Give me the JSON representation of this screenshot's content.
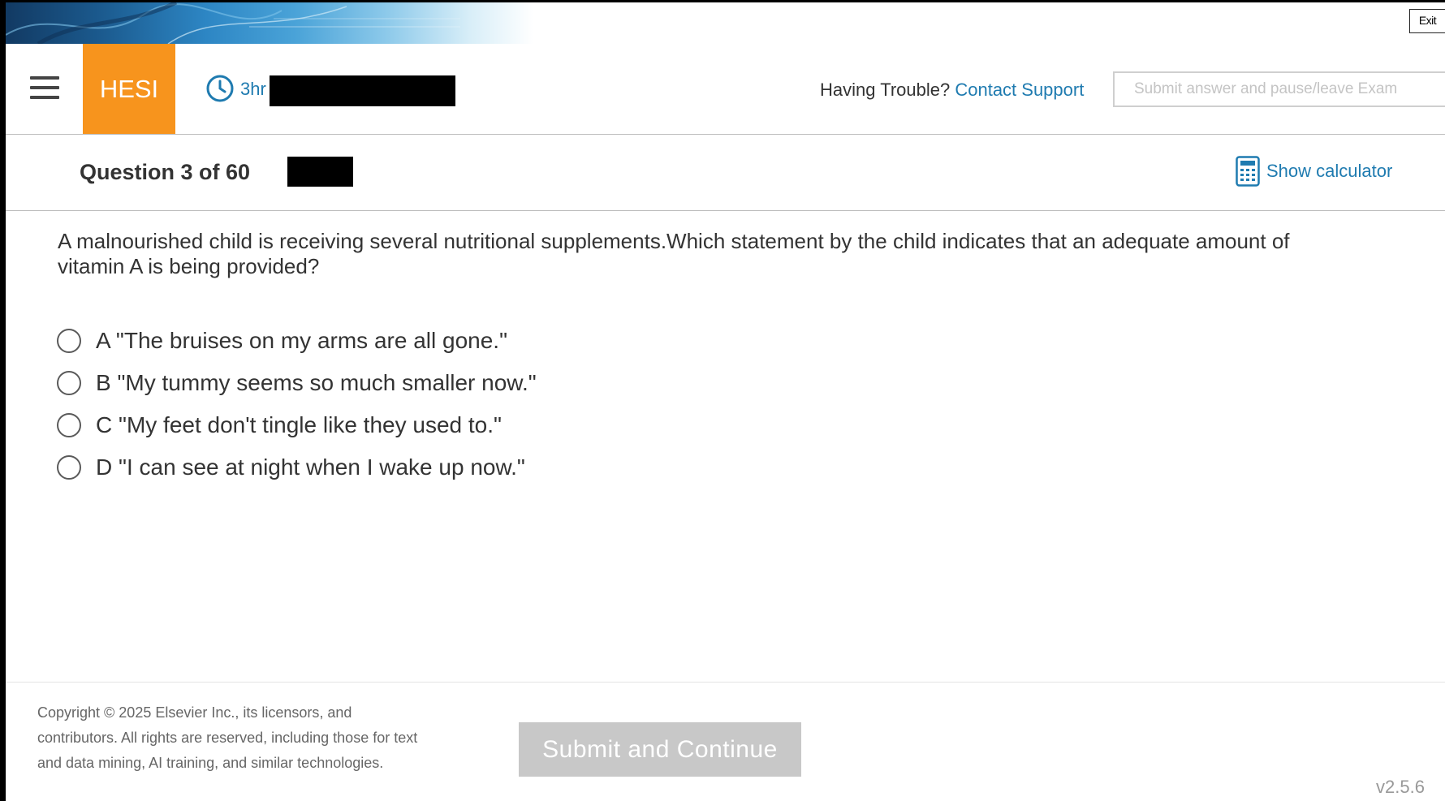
{
  "window": {
    "exit_label": "Exit"
  },
  "header": {
    "logo_text": "HESI",
    "timer_text": "3hr",
    "trouble_text": "Having Trouble?",
    "support_link": "Contact Support",
    "submit_pause_label": "Submit answer and pause/leave Exam"
  },
  "question_bar": {
    "question_label": "Question 3 of 60",
    "calculator_label": "Show calculator"
  },
  "question": {
    "stem": "A malnourished child is receiving several nutritional supplements.Which statement by the child indicates that an adequate amount of vitamin A is being provided?",
    "options": [
      {
        "letter": "A",
        "text": "\"The bruises on my arms are all gone.\""
      },
      {
        "letter": "B",
        "text": "\"My tummy seems so much smaller now.\""
      },
      {
        "letter": "C",
        "text": "\"My feet don't tingle like they used to.\""
      },
      {
        "letter": "D",
        "text": "\"I can see at night when I wake up now.\""
      }
    ]
  },
  "footer": {
    "copyright": "Copyright © 2025 Elsevier Inc., its licensors, and contributors. All rights are reserved, including those for text and data mining, AI training, and similar technologies.",
    "submit_label": "Submit and Continue",
    "version": "v2.5.6"
  },
  "colors": {
    "brand_orange": "#f7941d",
    "link_blue": "#1f7bb0",
    "disabled_gray": "#c8c8c8"
  },
  "icons": [
    "hamburger-menu-icon",
    "clock-icon",
    "calculator-icon"
  ]
}
